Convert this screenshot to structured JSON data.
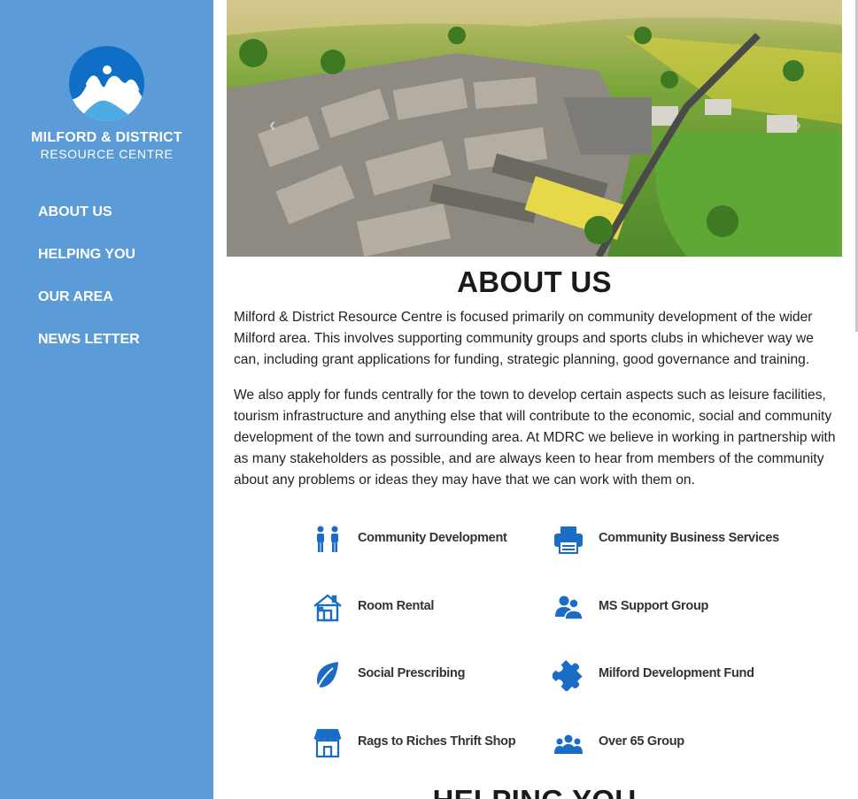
{
  "brand": {
    "name": "MILFORD & DISTRICT",
    "subtitle": "RESOURCE CENTRE",
    "colors": {
      "sidebar": "#5b9bd7",
      "logo": "#0f6fc6",
      "icon": "#1a6cc4"
    }
  },
  "nav": {
    "items": [
      {
        "label": "ABOUT US"
      },
      {
        "label": "HELPING YOU"
      },
      {
        "label": "OUR AREA"
      },
      {
        "label": "NEWS LETTER"
      }
    ]
  },
  "hero": {
    "prev_icon": "chevron-left-icon",
    "prev_glyph": "‹",
    "next_icon": "chevron-right-icon",
    "next_glyph": "›"
  },
  "about": {
    "title": "ABOUT US",
    "paragraphs": [
      "Milford & District Resource Centre is focused primarily on community development of the wider Milford area. This involves supporting community groups and sports clubs in whichever way we can, including grant applications for funding, strategic planning, good governance and training.",
      "We also apply for funds centrally for the town to develop certain aspects such as leisure facilities, tourism infrastructure and anything else that will contribute to the economic, social and community development of the town and surrounding area. At MDRC we believe in working in partnership with as many stakeholders as possible, and are always keen to hear from members of the community about any problems or ideas they may have that we can work with them on."
    ]
  },
  "services": [
    {
      "label": "Community Development",
      "icon": "people-icon"
    },
    {
      "label": "Community Business Services",
      "icon": "printer-icon"
    },
    {
      "label": "Room Rental",
      "icon": "house-icon"
    },
    {
      "label": "MS Support Group",
      "icon": "support-group-icon"
    },
    {
      "label": "Social Prescribing",
      "icon": "leaf-icon"
    },
    {
      "label": "Milford Development Fund",
      "icon": "puzzle-icon"
    },
    {
      "label": "Rags to Riches Thrift Shop",
      "icon": "shop-icon"
    },
    {
      "label": "Over 65 Group",
      "icon": "group-icon"
    }
  ],
  "next_section": {
    "title": "HELPING YOU"
  }
}
